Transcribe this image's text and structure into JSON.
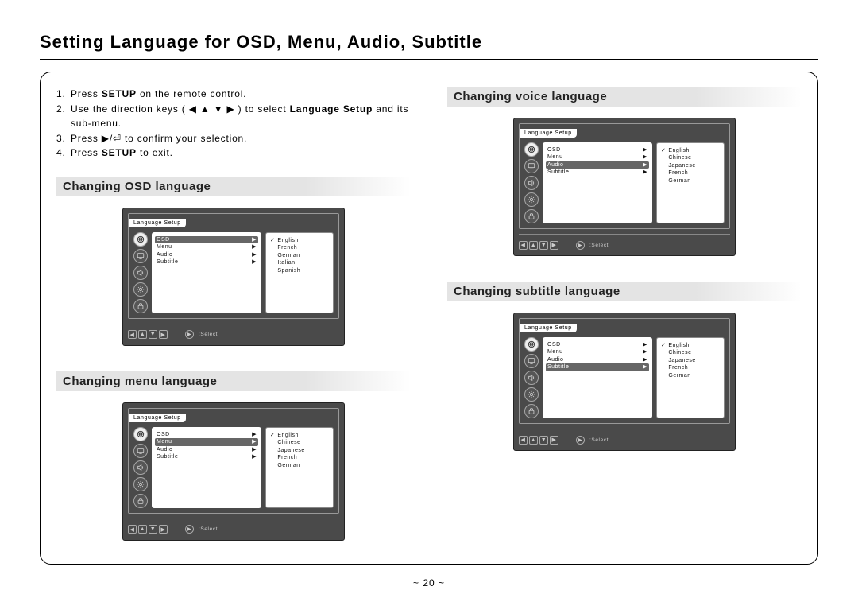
{
  "title": "Setting Language for OSD, Menu, Audio, Subtitle",
  "page_number": "~ 20 ~",
  "instructions": [
    {
      "num": "1.",
      "pre": "Press ",
      "bold": "SETUP",
      "post": " on the remote control."
    },
    {
      "num": "2.",
      "pre": "Use the direction keys ( ◀ ▲ ▼ ▶ ) to select ",
      "bold": "Language Setup",
      "post": " and its sub-menu."
    },
    {
      "num": "3.",
      "pre": "Press ▶/⏎ to confirm your selection.",
      "bold": "",
      "post": ""
    },
    {
      "num": "4.",
      "pre": "Press ",
      "bold": "SETUP",
      "post": " to exit."
    }
  ],
  "sections": {
    "osd": {
      "heading": "Changing OSD language"
    },
    "menu": {
      "heading": "Changing menu language"
    },
    "voice": {
      "heading": "Changing voice language"
    },
    "subtitle": {
      "heading": "Changing subtitle language"
    }
  },
  "osd_common": {
    "tab": "Language Setup",
    "menu_items": [
      "OSD",
      "Menu",
      "Audio",
      "Subtitle"
    ],
    "footer_label": ":Select"
  },
  "screens": {
    "osd": {
      "highlight_index": 0,
      "options": [
        "English",
        "French",
        "German",
        "Italian",
        "Spanish"
      ],
      "selected": "English"
    },
    "menu": {
      "highlight_index": 1,
      "options": [
        "English",
        "Chinese",
        "Japanese",
        "French",
        "German"
      ],
      "selected": "English"
    },
    "voice": {
      "highlight_index": 2,
      "options": [
        "English",
        "Chinese",
        "Japanese",
        "French",
        "German"
      ],
      "selected": "English"
    },
    "subtitle": {
      "highlight_index": 3,
      "options": [
        "English",
        "Chinese",
        "Japanese",
        "French",
        "German"
      ],
      "selected": "English"
    }
  }
}
